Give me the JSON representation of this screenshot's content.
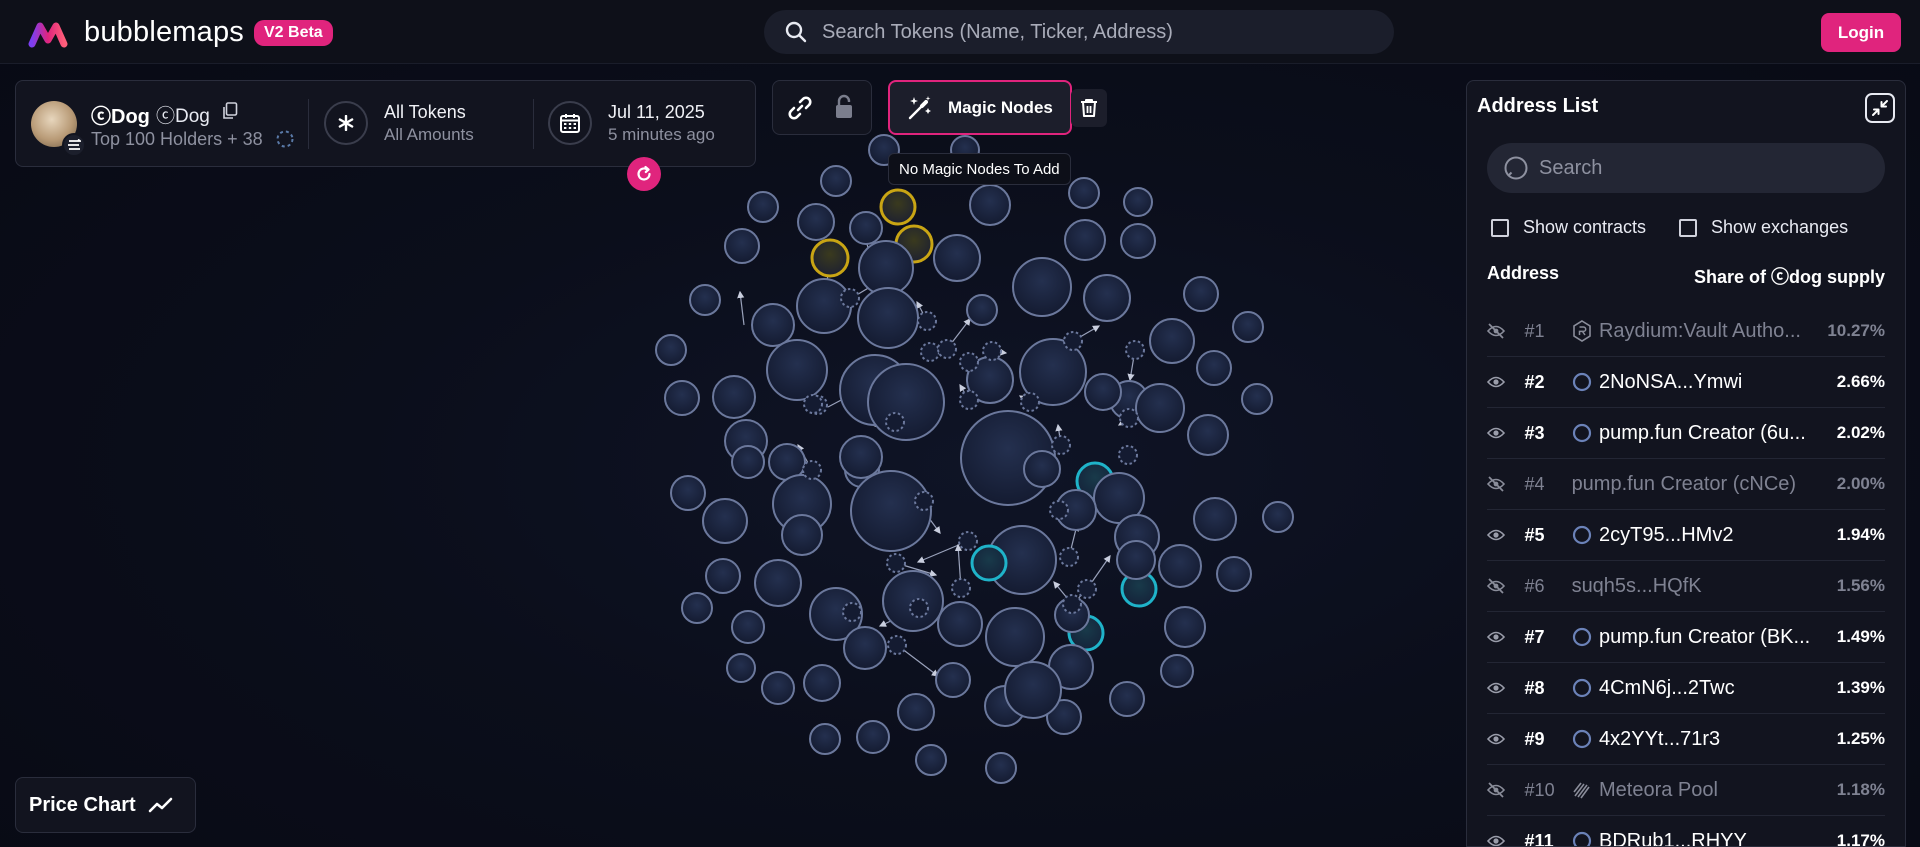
{
  "brand": {
    "name": "bubblemaps",
    "badge": "V2 Beta"
  },
  "search": {
    "placeholder": "Search Tokens (Name, Ticker, Address)"
  },
  "auth": {
    "login_label": "Login"
  },
  "token": {
    "name": "ⓒDog",
    "ticker": "ⓒDog",
    "holders_text": "Top 100 Holders + 38"
  },
  "filters": {
    "tokens_title": "All Tokens",
    "tokens_sub": "All Amounts",
    "date_title": "Jul 11, 2025",
    "date_sub": "5 minutes ago"
  },
  "toolbar": {
    "magic_label": "Magic Nodes",
    "magic_tooltip": "No Magic Nodes To Add"
  },
  "price_chart": {
    "label": "Price Chart"
  },
  "address_list": {
    "title": "Address List",
    "search_placeholder": "Search",
    "show_contracts": "Show contracts",
    "show_exchanges": "Show exchanges",
    "col_address": "Address",
    "col_share": "Share of ⓒdog supply",
    "rows": [
      {
        "rank": "#1",
        "name": "Raydium:Vault Autho...",
        "pct": "10.27%",
        "hidden": true,
        "icon": "raydium-icon"
      },
      {
        "rank": "#2",
        "name": "2NoNSA...Ymwi",
        "pct": "2.66%",
        "hidden": false,
        "icon": "wallet-icon"
      },
      {
        "rank": "#3",
        "name": "pump.fun Creator (6u...",
        "pct": "2.02%",
        "hidden": false,
        "icon": "wallet-icon"
      },
      {
        "rank": "#4",
        "name": "pump.fun Creator (cNCe)",
        "pct": "2.00%",
        "hidden": true,
        "icon": "none"
      },
      {
        "rank": "#5",
        "name": "2cyT95...HMv2",
        "pct": "1.94%",
        "hidden": false,
        "icon": "wallet-icon"
      },
      {
        "rank": "#6",
        "name": "suqh5s...HQfK",
        "pct": "1.56%",
        "hidden": true,
        "icon": "none"
      },
      {
        "rank": "#7",
        "name": "pump.fun Creator (BK...",
        "pct": "1.49%",
        "hidden": false,
        "icon": "wallet-icon"
      },
      {
        "rank": "#8",
        "name": "4CmN6j...2Twc",
        "pct": "1.39%",
        "hidden": false,
        "icon": "wallet-icon"
      },
      {
        "rank": "#9",
        "name": "4x2YYt...71r3",
        "pct": "1.25%",
        "hidden": false,
        "icon": "wallet-icon"
      },
      {
        "rank": "#10",
        "name": "Meteora Pool",
        "pct": "1.18%",
        "hidden": true,
        "icon": "meteora-icon"
      },
      {
        "rank": "#11",
        "name": "BDRub1...RHYY",
        "pct": "1.17%",
        "hidden": false,
        "icon": "wallet-icon"
      }
    ]
  },
  "colors": {
    "accent": "#e0247d",
    "bubble_default": "#1c2540",
    "bubble_stroke": "#6b789c",
    "bubble_yellow": "#c9a514",
    "bubble_cyan": "#1fb3c9"
  }
}
